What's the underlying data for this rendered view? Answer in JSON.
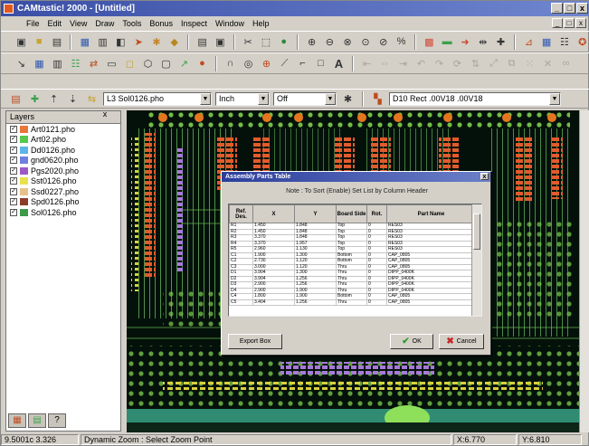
{
  "app": {
    "title": "CAMtastic! 2000 - [Untitled]",
    "window_controls": [
      "_",
      "□",
      "x"
    ]
  },
  "menu": [
    "File",
    "Edit",
    "View",
    "Draw",
    "Tools",
    "Bonus",
    "Inspect",
    "Window",
    "Help"
  ],
  "menu_right_controls": [
    "_",
    "□",
    "x"
  ],
  "toolbar4": {
    "layer_combo": "L3 Sol0126.pho",
    "units_combo": "Inch",
    "mode_combo": "Off",
    "dcode_combo": "D10  Rect  .00V18 .00V18"
  },
  "layers": {
    "header": "Layers",
    "items": [
      {
        "name": "Art0121.pho",
        "color": "#e8763a"
      },
      {
        "name": "Art02.pho",
        "color": "#56c84c"
      },
      {
        "name": "Dd0126.pho",
        "color": "#5db4e6"
      },
      {
        "name": "gnd0620.pho",
        "color": "#6f7fe0"
      },
      {
        "name": "Pgs2020.pho",
        "color": "#9b5ac8"
      },
      {
        "name": "Sst0126.pho",
        "color": "#e8e24a"
      },
      {
        "name": "Ssd0227.pho",
        "color": "#e7c08a"
      },
      {
        "name": "Spd0126.pho",
        "color": "#8b3d2a"
      },
      {
        "name": "Sol0126.pho",
        "color": "#3d9a4a"
      }
    ]
  },
  "status": {
    "coords": "9.5001c 3.326",
    "message": "Dynamic Zoom : Select Zoom Point",
    "x": "X:6.770",
    "y": "Y:6.810"
  },
  "dialog": {
    "title": "Assembly Parts Table",
    "note": "Note : To Sort (Enable) Set List by Column Header",
    "columns": [
      "Ref. Des.",
      "X",
      "Y",
      "Board Side",
      "Rot.",
      "Part Name"
    ],
    "rows": [
      [
        "R1",
        "1.450",
        "1.848",
        "Top",
        "0",
        "RES03"
      ],
      [
        "R2",
        "1.450",
        "1.848",
        "Top",
        "0",
        "RES03"
      ],
      [
        "R3",
        "3.370",
        "1.848",
        "Top",
        "0",
        "RES03"
      ],
      [
        "R4",
        "3.370",
        "1.957",
        "Top",
        "0",
        "RES03"
      ],
      [
        "R5",
        "2.960",
        "1.130",
        "Top",
        "0",
        "RES03"
      ],
      [
        "C1",
        "1.900",
        "1.300",
        "Bottom",
        "0",
        "CAP_0805"
      ],
      [
        "C2",
        "2.730",
        "1.120",
        "Bottom",
        "0",
        "CAP_0805"
      ],
      [
        "C3",
        "3.000",
        "1.120",
        "Thru",
        "0",
        "CAP_0805"
      ],
      [
        "D1",
        "3.904",
        "1.300",
        "Thru",
        "0",
        "DIPP_0400K"
      ],
      [
        "D2",
        "3.904",
        "1.256",
        "Thru",
        "0",
        "DIPP_0400K"
      ],
      [
        "D3",
        "2.900",
        "1.256",
        "Thru",
        "0",
        "DIPP_0400K"
      ],
      [
        "D4",
        "2.900",
        "1.900",
        "Thru",
        "0",
        "DIPP_0400K"
      ],
      [
        "C4",
        "1.800",
        "1.900",
        "Bottom",
        "0",
        "CAP_0805"
      ],
      [
        "C5",
        "3.404",
        "1.256",
        "Thru",
        "0",
        "CAP_0805"
      ]
    ],
    "export_label": "Export Box",
    "ok_label": "OK",
    "cancel_label": "Cancel"
  }
}
